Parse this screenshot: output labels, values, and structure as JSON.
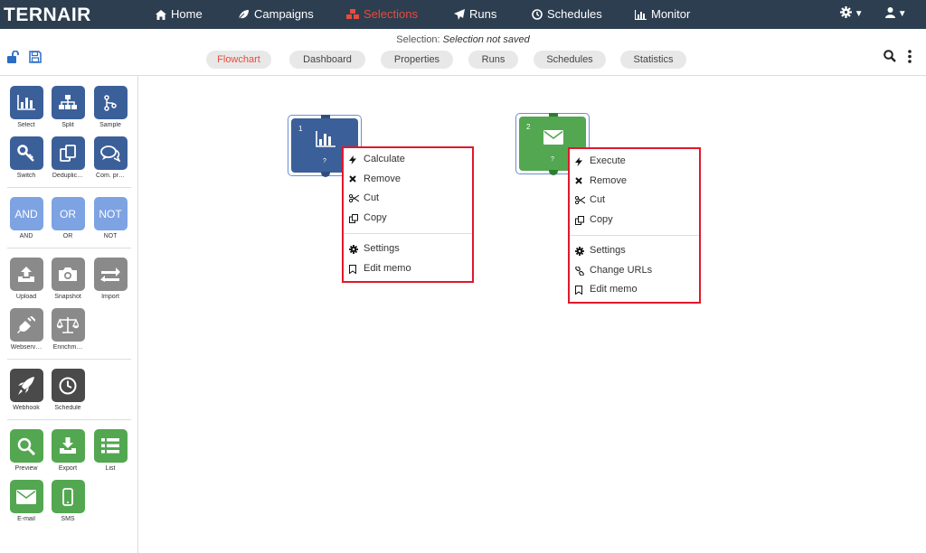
{
  "app": {
    "logo": "TERNAIR"
  },
  "nav": {
    "items": [
      {
        "label": "Home",
        "icon": "home-icon"
      },
      {
        "label": "Campaigns",
        "icon": "leaf-icon"
      },
      {
        "label": "Selections",
        "icon": "cubes-icon",
        "active": true
      },
      {
        "label": "Runs",
        "icon": "paper-plane-icon"
      },
      {
        "label": "Schedules",
        "icon": "clock-icon"
      },
      {
        "label": "Monitor",
        "icon": "bar-chart-icon"
      }
    ],
    "settings_icon": "gear-icon",
    "user_icon": "user-icon",
    "accent": "#e74c3c",
    "background": "#2c3e50"
  },
  "toolbar": {
    "status_prefix": "Selection:",
    "status_value": "Selection not saved",
    "tabs": [
      {
        "label": "Flowchart",
        "active": true
      },
      {
        "label": "Dashboard"
      },
      {
        "label": "Properties"
      },
      {
        "label": "Runs"
      },
      {
        "label": "Schedules"
      },
      {
        "label": "Statistics"
      }
    ],
    "left_icons": [
      "unlock-icon",
      "save-icon"
    ],
    "right_icons": [
      "search-icon",
      "more-vertical-icon"
    ]
  },
  "palette": {
    "items": [
      {
        "label": "Select",
        "icon": "bar-chart-icon",
        "color": "#3b5f99"
      },
      {
        "label": "Split",
        "icon": "sitemap-icon",
        "color": "#3b5f99"
      },
      {
        "label": "Sample",
        "icon": "branch-icon",
        "color": "#3b5f99"
      },
      {
        "label": "Switch",
        "icon": "key-icon",
        "color": "#3b5f99"
      },
      {
        "label": "Deduplic…",
        "icon": "copy-icon",
        "color": "#3b5f99"
      },
      {
        "label": "Com. pr…",
        "icon": "comments-icon",
        "color": "#3b5f99"
      },
      {
        "label": "AND",
        "text": "AND",
        "color": "#7ea3e3"
      },
      {
        "label": "OR",
        "text": "OR",
        "color": "#7ea3e3"
      },
      {
        "label": "NOT",
        "text": "NOT",
        "color": "#7ea3e3"
      },
      {
        "label": "Upload",
        "icon": "upload-icon",
        "color": "#8a8a8a"
      },
      {
        "label": "Snapshot",
        "icon": "camera-icon",
        "color": "#8a8a8a"
      },
      {
        "label": "Import",
        "icon": "exchange-icon",
        "color": "#8a8a8a"
      },
      {
        "label": "Webserv…",
        "icon": "plug-icon",
        "color": "#8a8a8a"
      },
      {
        "label": "Enrichm…",
        "icon": "balance-scale-icon",
        "color": "#8a8a8a"
      },
      {
        "label": "Webhook",
        "icon": "rocket-icon",
        "color": "#4a4a4a"
      },
      {
        "label": "Schedule",
        "icon": "clock-icon",
        "color": "#4a4a4a"
      },
      {
        "label": "Preview",
        "icon": "search-icon",
        "color": "#53a750"
      },
      {
        "label": "Export",
        "icon": "download-icon",
        "color": "#53a750"
      },
      {
        "label": "List",
        "icon": "list-icon",
        "color": "#53a750"
      },
      {
        "label": "E-mail",
        "icon": "envelope-icon",
        "color": "#53a750"
      },
      {
        "label": "SMS",
        "icon": "mobile-icon",
        "color": "#53a750"
      }
    ]
  },
  "canvas": {
    "nodes": [
      {
        "number": "1",
        "status": "?",
        "icon": "bar-chart-icon",
        "color": "#3b5f99"
      },
      {
        "number": "2",
        "status": "?",
        "icon": "envelope-icon",
        "color": "#53a750"
      }
    ],
    "menu1": {
      "items": [
        {
          "label": "Calculate",
          "icon": "bolt-icon"
        },
        {
          "label": "Remove",
          "icon": "times-icon"
        },
        {
          "label": "Cut",
          "icon": "scissors-icon"
        },
        {
          "label": "Copy",
          "icon": "copy-icon"
        },
        {
          "separator": true
        },
        {
          "label": "Settings",
          "icon": "gear-icon"
        },
        {
          "label": "Edit memo",
          "icon": "bookmark-icon"
        }
      ]
    },
    "menu2": {
      "items": [
        {
          "label": "Execute",
          "icon": "bolt-icon"
        },
        {
          "label": "Remove",
          "icon": "times-icon"
        },
        {
          "label": "Cut",
          "icon": "scissors-icon"
        },
        {
          "label": "Copy",
          "icon": "copy-icon"
        },
        {
          "separator": true
        },
        {
          "label": "Settings",
          "icon": "gear-icon"
        },
        {
          "label": "Change URLs",
          "icon": "link-icon"
        },
        {
          "label": "Edit memo",
          "icon": "bookmark-icon"
        }
      ]
    }
  }
}
